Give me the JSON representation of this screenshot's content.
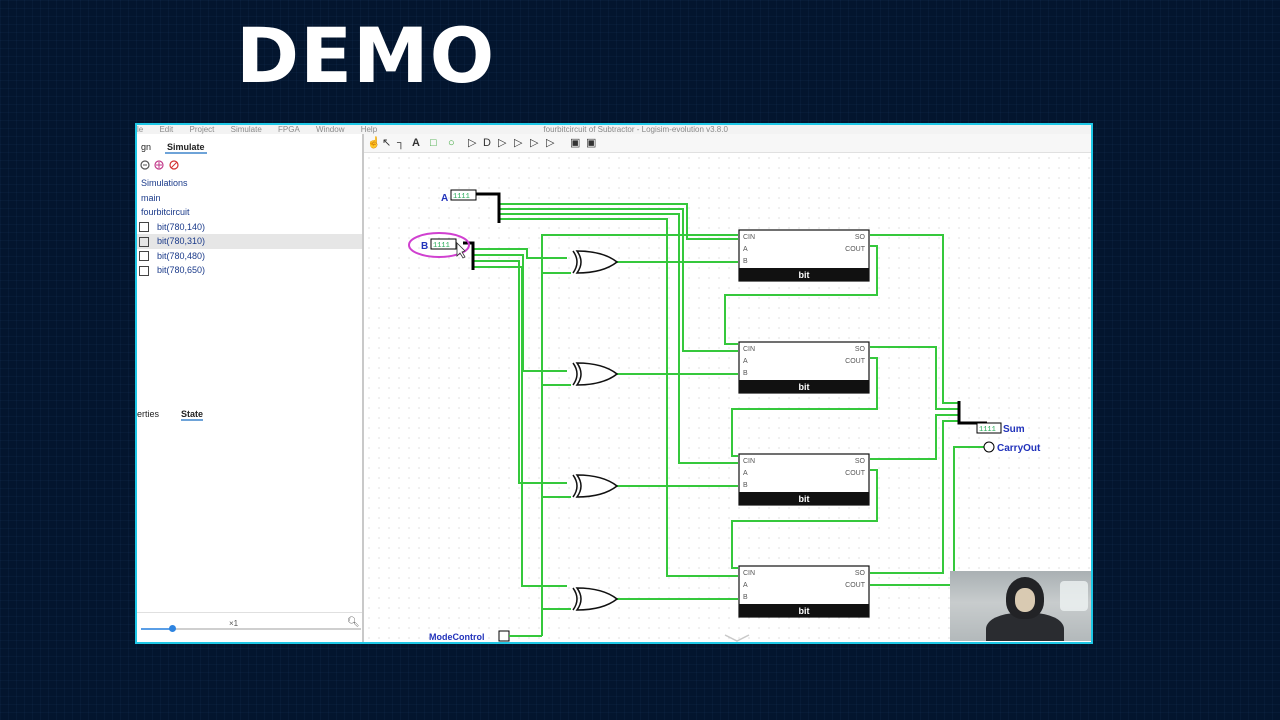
{
  "slide": {
    "title": "DEMO"
  },
  "window": {
    "menu": [
      "le",
      "Edit",
      "Project",
      "Simulate",
      "FPGA",
      "Window",
      "Help"
    ],
    "title": "fourbitcircuit of Subtractor - Logisim-evolution v3.8.0"
  },
  "left_panel": {
    "tabs": [
      "gn",
      "Simulate"
    ],
    "active_tab": "Simulate",
    "tree": [
      {
        "label": "Simulations",
        "selected": false
      },
      {
        "label": "main",
        "selected": false
      },
      {
        "label": "fourbitcircuit",
        "selected": false
      },
      {
        "label": "bit(780,140)",
        "selected": false
      },
      {
        "label": "bit(780,310)",
        "selected": true
      },
      {
        "label": "bit(780,480)",
        "selected": false
      },
      {
        "label": "bit(780,650)",
        "selected": false
      }
    ],
    "props_tabs": [
      "erties",
      "State"
    ],
    "props_active": "State",
    "zoom_label": "×1",
    "zoom_level": 0.14
  },
  "circuit": {
    "input_a": "A",
    "input_b": "B",
    "mode_control": "ModeControl",
    "sum": "Sum",
    "carry_out": "CarryOut",
    "adder_label": "bit",
    "ports": {
      "cin": "CIN",
      "a": "A",
      "b": "B",
      "so": "SO",
      "cout": "COUT"
    },
    "adder_count": 4,
    "xor_count": 4
  },
  "colors": {
    "background": "#03152e",
    "frame_border": "#1ec7e6",
    "wire_on": "#35c83c",
    "wire_bus": "#000000",
    "label": "#2233bb",
    "highlight": "#d040d0"
  }
}
